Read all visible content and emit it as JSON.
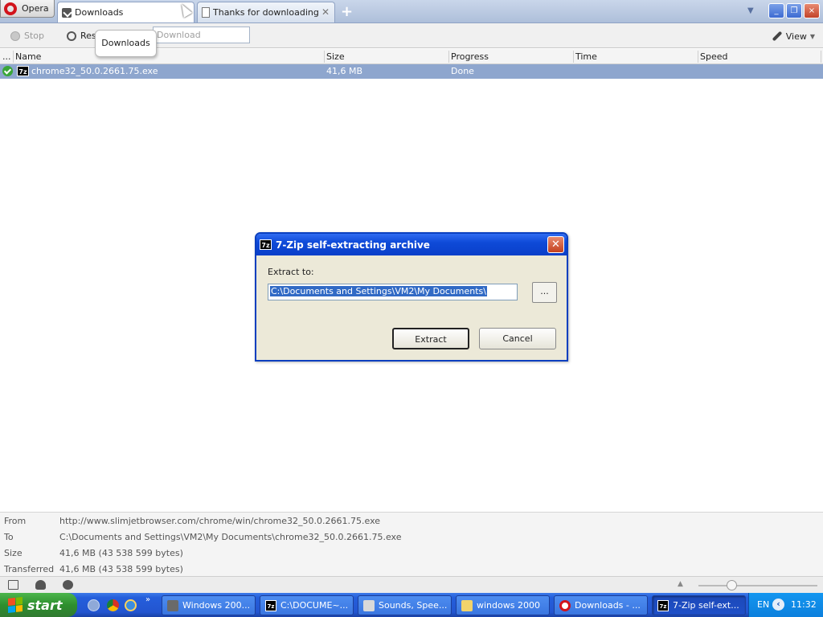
{
  "browser": {
    "menu_label": "Opera",
    "tabs": [
      {
        "label": "Downloads",
        "active": true
      },
      {
        "label": "Thanks for downloading ...",
        "active": false
      }
    ],
    "new_tab_symbol": "+",
    "window_controls": [
      "_",
      "❐",
      "×"
    ]
  },
  "toolbar": {
    "stop_label": "Stop",
    "resume_label": "Res",
    "quick_download_placeholder": "Download",
    "view_label": "View"
  },
  "tooltip": {
    "text": "Downloads"
  },
  "columns": {
    "dots": "...",
    "name": "Name",
    "size": "Size",
    "progress": "Progress",
    "time": "Time",
    "speed": "Speed"
  },
  "downloads": [
    {
      "name": "chrome32_50.0.2661.75.exe",
      "size": "41,6 MB",
      "progress": "Done",
      "time": "",
      "speed": ""
    }
  ],
  "dialog": {
    "title": "7-Zip self-extracting archive",
    "extract_to_label": "Extract to:",
    "path_value": "C:\\Documents and Settings\\VM2\\My Documents\\",
    "browse_label": "...",
    "extract_label": "Extract",
    "cancel_label": "Cancel",
    "close_symbol": "✕"
  },
  "details": {
    "from_label": "From",
    "from_value": "http://www.slimjetbrowser.com/chrome/win/chrome32_50.0.2661.75.exe",
    "to_label": "To",
    "to_value": "C:\\Documents and Settings\\VM2\\My Documents\\chrome32_50.0.2661.75.exe",
    "size_label": "Size",
    "size_value": "41,6 MB (43 538 599 bytes)",
    "transferred_label": "Transferred",
    "transferred_value": "41,6 MB (43 538 599 bytes)"
  },
  "taskbar": {
    "start_label": "start",
    "quicklaunch_more": "»",
    "tasks": [
      {
        "label": "Windows 200...",
        "icon": "window-icon",
        "active": false
      },
      {
        "label": "C:\\DOCUME~...",
        "icon": "7zip-icon",
        "active": false
      },
      {
        "label": "Sounds, Spee...",
        "icon": "sound-icon",
        "active": false
      },
      {
        "label": "windows 2000",
        "icon": "folder-icon",
        "active": false
      },
      {
        "label": "Downloads - ...",
        "icon": "opera-icon",
        "active": false
      },
      {
        "label": "7-Zip self-ext...",
        "icon": "7zip-icon",
        "active": true
      }
    ],
    "tray": {
      "language": "EN",
      "back_symbol": "‹",
      "clock": "11:32"
    }
  },
  "icons": {
    "sevenzip_text": "7z",
    "check": "check-icon"
  },
  "colors": {
    "selection_row": "#8ea6ce",
    "xp_title_blue": "#0a3fc9",
    "start_green": "#2e8f2e"
  }
}
